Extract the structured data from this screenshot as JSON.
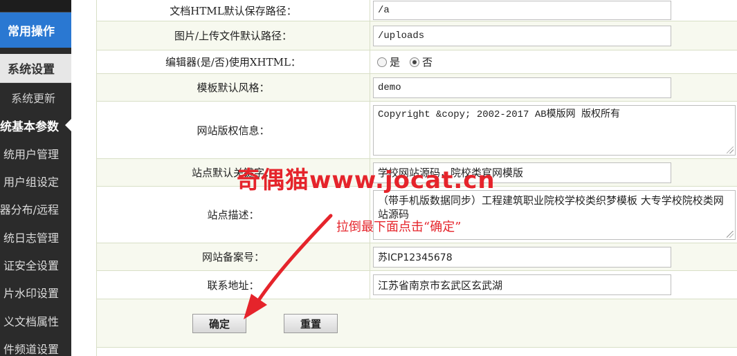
{
  "sidebar": {
    "group_common": "常用操作",
    "group_system": "系统设置",
    "items": [
      {
        "label": "系统更新"
      },
      {
        "label": "统基本参数"
      },
      {
        "label": "统用户管理"
      },
      {
        "label": "用户组设定"
      },
      {
        "label": "器分布/远程"
      },
      {
        "label": "统日志管理"
      },
      {
        "label": "证安全设置"
      },
      {
        "label": "片水印设置"
      },
      {
        "label": "义文档属性"
      },
      {
        "label": "件频道设置"
      }
    ]
  },
  "form": {
    "rows": [
      {
        "label": "文档HTML默认保存路径：",
        "value": "/a"
      },
      {
        "label": "图片/上传文件默认路径：",
        "value": "/uploads"
      },
      {
        "label": "编辑器(是/否)使用XHTML：",
        "radio_yes": "是",
        "radio_no": "否",
        "selected": "否"
      },
      {
        "label": "模板默认风格：",
        "value": "demo"
      },
      {
        "label": "网站版权信息：",
        "value": "Copyright &copy; 2002-2017 AB模版网 版权所有"
      },
      {
        "label": "站点默认关键字：",
        "value": "学校网站源码，院校类官网模版"
      },
      {
        "label": "站点描述：",
        "value": "（带手机版数据同步）工程建筑职业院校学校类织梦模板 大专学校院校类网站源码"
      },
      {
        "label": "网站备案号：",
        "value": "苏ICP12345678"
      },
      {
        "label": "联系地址：",
        "value": "江苏省南京市玄武区玄武湖"
      }
    ],
    "ok_button": "确定",
    "reset_button": "重置"
  },
  "overlay": {
    "watermark": "奇偶猫www.jocat.cn",
    "note": "拉倒最下面点击“确定”",
    "accent_color": "#e5242b"
  }
}
